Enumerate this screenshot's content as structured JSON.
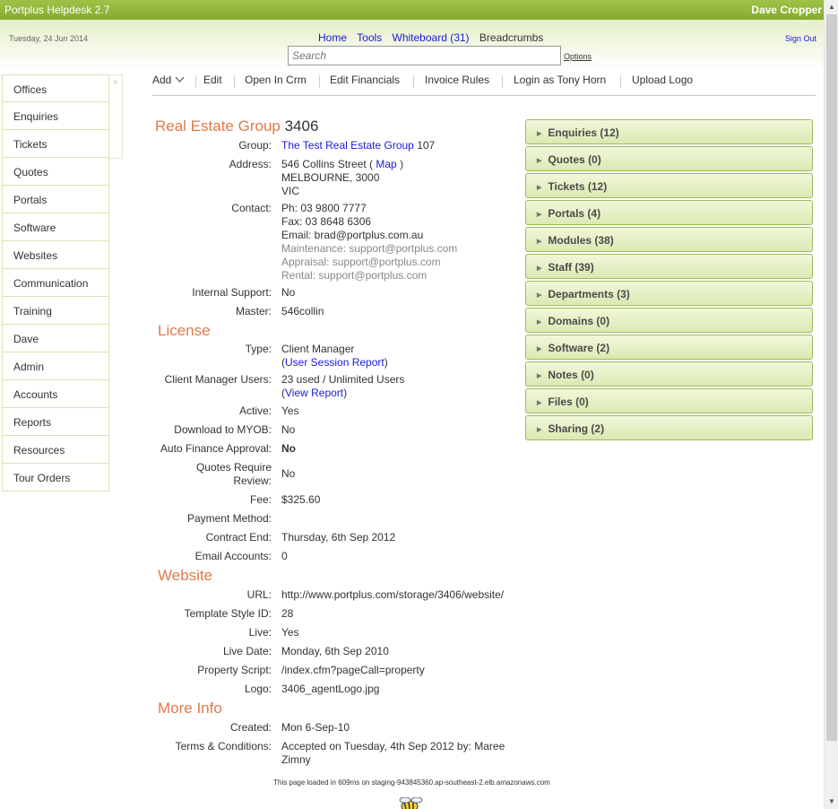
{
  "app": {
    "title": "Portplus Helpdesk 2.7",
    "user": "Dave Cropper"
  },
  "header": {
    "date": "Tuesday, 24 Jun 2014",
    "nav": {
      "home": "Home",
      "tools": "Tools",
      "whiteboard": "Whiteboard (31)",
      "breadcrumbs": "Breadcrumbs"
    },
    "signout": "Sign Out",
    "search_placeholder": "Search",
    "options": "Options"
  },
  "sidebar": {
    "collapse_icon": "«",
    "items": [
      "Offices",
      "Enquiries",
      "Tickets",
      "Quotes",
      "Portals",
      "Software",
      "Websites",
      "Communication",
      "Training",
      "Dave",
      "Admin",
      "Accounts",
      "Reports",
      "Resources",
      "Tour Orders"
    ]
  },
  "toolbar": {
    "add": "Add",
    "edit": "Edit",
    "open_in_crm": "Open In Crm",
    "edit_financials": "Edit Financials",
    "invoice_rules": "Invoice Rules",
    "login_as": "Login as Tony Horn",
    "upload_logo": "Upload Logo"
  },
  "office": {
    "name": "Real Estate Group",
    "id": "3406",
    "group_label": "Group:",
    "group_name": "The Test Real Estate Group",
    "group_id": "107",
    "address_label": "Address:",
    "address_street": "546 Collins Street (",
    "map_link": "Map",
    "address_close": ")",
    "address_city": "MELBOURNE, 3000",
    "address_state": "VIC",
    "contact_label": "Contact:",
    "phone": "Ph: 03 9800 7777",
    "fax": "Fax: 03 8648 6306",
    "email": "Email: brad@portplus.com.au",
    "maintenance": "Maintenance: support@portplus.com",
    "appraisal": "Appraisal: support@portplus.com",
    "rental": "Rental: support@portplus.com",
    "internal_support_label": "Internal Support:",
    "internal_support": "No",
    "master_label": "Master:",
    "master": "546collin"
  },
  "license": {
    "title": "License",
    "type_label": "Type:",
    "type": "Client Manager",
    "session_report": "User Session Report",
    "cm_users_label": "Client Manager Users:",
    "cm_users": "23 used / Unlimited Users",
    "view_report": "View Report",
    "active_label": "Active:",
    "active": "Yes",
    "myob_label": "Download to MYOB:",
    "myob": "No",
    "auto_finance_label": "Auto Finance Approval:",
    "auto_finance": "No",
    "quotes_review_label_1": "Quotes Require",
    "quotes_review_label_2": "Review:",
    "quotes_review": "No",
    "fee_label": "Fee:",
    "fee": "$325.60",
    "payment_label": "Payment Method:",
    "payment": "",
    "contract_end_label": "Contract End:",
    "contract_end": "Thursday, 6th Sep 2012",
    "email_accounts_label": "Email Accounts:",
    "email_accounts": "0"
  },
  "website": {
    "title": "Website",
    "url_label": "URL:",
    "url": "http://www.portplus.com/storage/3406/website/",
    "template_label": "Template Style ID:",
    "template": "28",
    "live_label": "Live:",
    "live": "Yes",
    "live_date_label": "Live Date:",
    "live_date": "Monday, 6th Sep 2010",
    "property_script_label": "Property Script:",
    "property_script": "/index.cfm?pageCall=property",
    "logo_label": "Logo:",
    "logo": "3406_agentLogo.jpg"
  },
  "more_info": {
    "title": "More Info",
    "created_label": "Created:",
    "created": "Mon 6-Sep-10",
    "terms_label": "Terms & Conditions:",
    "terms_1": "Accepted on Tuesday, 4th Sep 2012 by: Maree",
    "terms_2": "Zimny"
  },
  "panels": [
    "Enquiries (12)",
    "Quotes (0)",
    "Tickets (12)",
    "Portals (4)",
    "Modules (38)",
    "Staff (39)",
    "Departments (3)",
    "Domains (0)",
    "Software (2)",
    "Notes (0)",
    "Files (0)",
    "Sharing (2)"
  ],
  "footer": "This page loaded in 609ms on staging-943845360.ap-southeast-2.elb.amazonaws.com",
  "colors": {
    "accent_green": "#9fc248",
    "section_orange": "#e07a4a",
    "link_blue": "#1a1ad6"
  }
}
